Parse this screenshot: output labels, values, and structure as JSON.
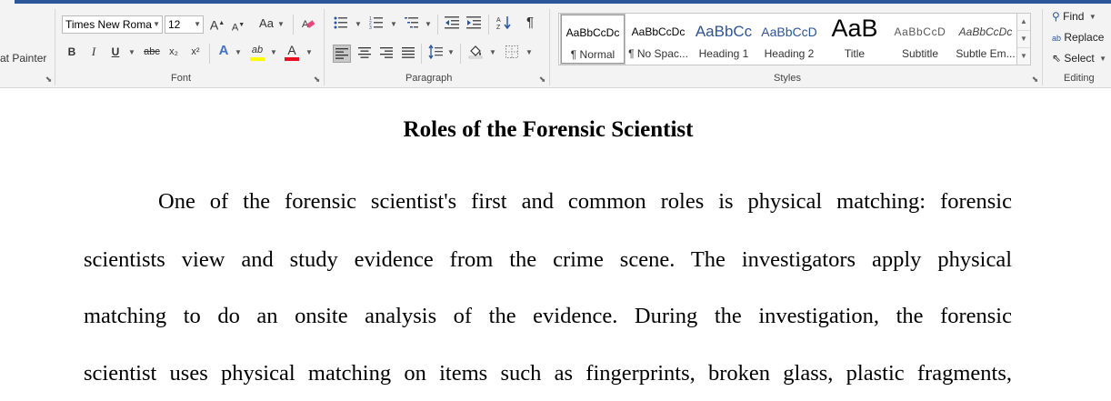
{
  "ribbon": {
    "clipboard": {
      "format_painter_label": "at Painter"
    },
    "font": {
      "group_label": "Font",
      "font_name": "Times New Roma",
      "font_size": "12",
      "grow_glyph": "A",
      "shrink_glyph": "A",
      "change_case_glyph": "Aa",
      "bold": "B",
      "italic": "I",
      "underline": "U",
      "strikethrough": "abc",
      "subscript": "x₂",
      "superscript": "x²",
      "text_effects_glyph": "A",
      "highlight_glyph": "ab",
      "font_color_glyph": "A",
      "font_color": "#e81123",
      "highlight_color": "#ffff00"
    },
    "paragraph": {
      "group_label": "Paragraph",
      "pilcrow": "¶"
    },
    "styles": {
      "group_label": "Styles",
      "items": [
        {
          "preview": "AaBbCcDc",
          "name": "¶ Normal"
        },
        {
          "preview": "AaBbCcDc",
          "name": "¶ No Spac..."
        },
        {
          "preview": "AaBbCc",
          "name": "Heading 1"
        },
        {
          "preview": "AaBbCcD",
          "name": "Heading 2"
        },
        {
          "preview": "AaB",
          "name": "Title"
        },
        {
          "preview": "AaBbCcD",
          "name": "Subtitle"
        },
        {
          "preview": "AaBbCcDc",
          "name": "Subtle Em..."
        }
      ]
    },
    "editing": {
      "group_label": "Editing",
      "find_label": "Find",
      "replace_label": "Replace",
      "select_label": "Select"
    }
  },
  "document": {
    "title": "Roles of the Forensic Scientist",
    "lines": [
      "One of the forensic scientist's first and common roles is physical matching: forensic",
      "scientists view and study evidence from the crime scene. The investigators apply physical",
      "matching to do an onsite analysis of the evidence. During the investigation, the forensic",
      "scientist uses physical matching on items such as fingerprints, broken glass, plastic fragments,"
    ]
  }
}
